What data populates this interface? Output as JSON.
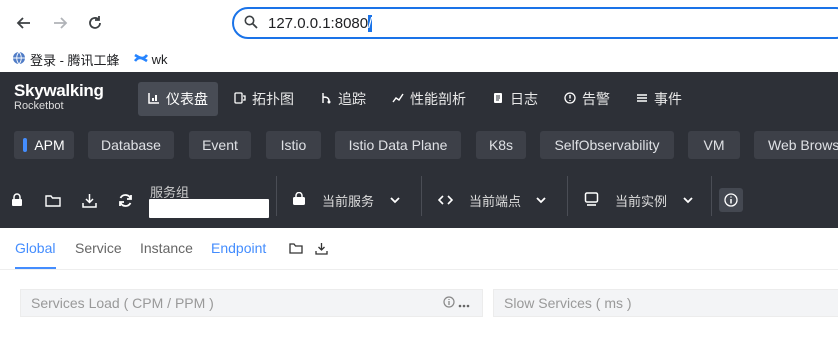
{
  "browser": {
    "url": "127.0.0.1:8080",
    "url_tail": "/",
    "bookmarks": [
      {
        "label": "登录 - 腾讯工蜂"
      },
      {
        "label": "wk"
      }
    ]
  },
  "header": {
    "logo_line1": "Skywalking",
    "logo_line2": "Rocketbot",
    "menu": [
      {
        "label": "仪表盘",
        "icon": "dashboard-icon"
      },
      {
        "label": "拓扑图",
        "icon": "topology-icon"
      },
      {
        "label": "追踪",
        "icon": "trace-icon"
      },
      {
        "label": "性能剖析",
        "icon": "profile-icon"
      },
      {
        "label": "日志",
        "icon": "log-icon"
      },
      {
        "label": "告警",
        "icon": "alarm-icon"
      },
      {
        "label": "事件",
        "icon": "event-icon"
      }
    ]
  },
  "layers": [
    "APM",
    "Database",
    "Event",
    "Istio",
    "Istio Data Plane",
    "K8s",
    "SelfObservability",
    "VM",
    "Web Browse"
  ],
  "toolbar": {
    "service_group_label": "服务组",
    "current_service": "当前服务",
    "current_endpoint": "当前端点",
    "current_instance": "当前实例"
  },
  "tabs": [
    "Global",
    "Service",
    "Instance",
    "Endpoint"
  ],
  "widgets": {
    "services_load": "Services Load ( CPM / PPM )",
    "slow_services": "Slow Services ( ms )"
  },
  "colors": {
    "accent": "#448dfe",
    "header_bg": "#2d3037",
    "layer_bg": "#3d4048"
  }
}
